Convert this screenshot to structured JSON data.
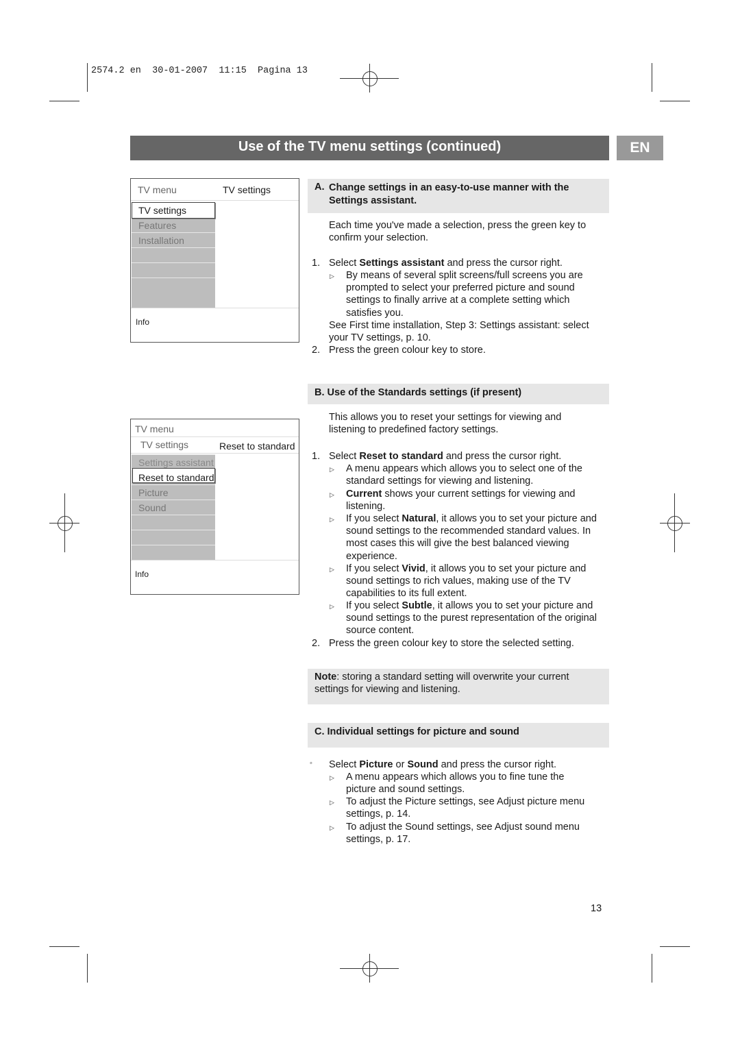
{
  "slug": "2574.2 en  30-01-2007  11:15  Pagina 13",
  "title": "Use of the TV menu settings (continued)",
  "lang_tab": "EN",
  "menu1": {
    "header_left": "TV menu",
    "header_right": "TV settings",
    "items": [
      "TV settings",
      "Features",
      "Installation"
    ],
    "selected": "TV settings",
    "info": "Info"
  },
  "menu2": {
    "header": "TV menu",
    "sub_left": "TV settings",
    "sub_right": "Reset to standard",
    "items": [
      "Settings assistant",
      "Reset to standard",
      "Picture",
      "Sound"
    ],
    "selected": "Reset to standard",
    "info": "Info"
  },
  "sectionA": {
    "heading_num": "A.",
    "heading": "Change settings in an easy-to-use manner with the Settings assistant.",
    "intro": "Each time you've made a selection, press the green key to confirm your selection.",
    "step1": {
      "num": "1.",
      "pre": "Select ",
      "bold": "Settings assistant",
      "post": " and press the cursor right."
    },
    "bullet1": "By means of several split screens/full screens you are prompted to select your preferred picture and sound settings to finally arrive at a complete setting which satisfies you.",
    "see": "See First time installation, Step 3: Settings assistant: select your TV settings, p. 10.",
    "step2": {
      "num": "2.",
      "text": "Press the green colour key to store."
    }
  },
  "sectionB": {
    "heading": "B. Use of the Standards settings (if present)",
    "intro": "This allows you to reset your settings for viewing and listening to predefined factory settings.",
    "step1": {
      "num": "1.",
      "pre": "Select ",
      "bold": "Reset to standard",
      "post": " and press the cursor right."
    },
    "bullets": [
      {
        "pre": "A menu appears which allows you to select one of the standard settings for viewing and listening.",
        "bold": "",
        "post": ""
      },
      {
        "pre": "",
        "bold": "Current",
        "post": " shows your current settings for viewing and listening."
      },
      {
        "pre": "If you select ",
        "bold": "Natural",
        "post": ", it allows you to set your picture and sound settings to the recommended standard values. In most cases this will give the best balanced viewing experience."
      },
      {
        "pre": "If you select ",
        "bold": "Vivid",
        "post": ", it allows you to set your picture and sound settings to rich values, making use of the TV capabilities to its full extent."
      },
      {
        "pre": "If you select ",
        "bold": "Subtle",
        "post": ", it allows you to set your picture and sound settings to the purest representation of the original source content."
      }
    ],
    "step2": {
      "num": "2.",
      "text": "Press the green colour key to store the selected setting."
    }
  },
  "note": {
    "bold": "Note",
    "text": ": storing a standard setting will overwrite your current settings for viewing and listening."
  },
  "sectionC": {
    "heading": "C. Individual settings for picture and sound",
    "step": {
      "pre": "Select ",
      "b1": "Picture",
      "mid": " or ",
      "b2": "Sound",
      "post": " and press the cursor right."
    },
    "bullets": [
      "A menu appears which allows you to fine tune the picture and sound settings.",
      "To adjust the Picture settings, see Adjust picture menu settings, p. 14.",
      "To adjust the Sound settings, see Adjust sound menu settings, p. 17."
    ]
  },
  "page_number": "13"
}
